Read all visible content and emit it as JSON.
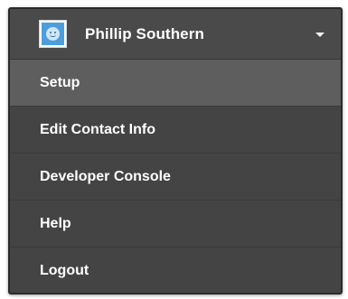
{
  "user": {
    "name": "Phillip Southern",
    "avatar_icon": "user-avatar-icon",
    "dropdown_icon": "caret-down-icon"
  },
  "menu": {
    "items": [
      {
        "label": "Setup",
        "active": true
      },
      {
        "label": "Edit Contact Info",
        "active": false
      },
      {
        "label": "Developer Console",
        "active": false
      },
      {
        "label": "Help",
        "active": false
      },
      {
        "label": "Logout",
        "active": false
      }
    ]
  },
  "colors": {
    "menu_bg": "#444444",
    "active_item_bg": "#5e5e5e",
    "avatar_blue": "#4d9fdc",
    "text": "#ffffff"
  }
}
